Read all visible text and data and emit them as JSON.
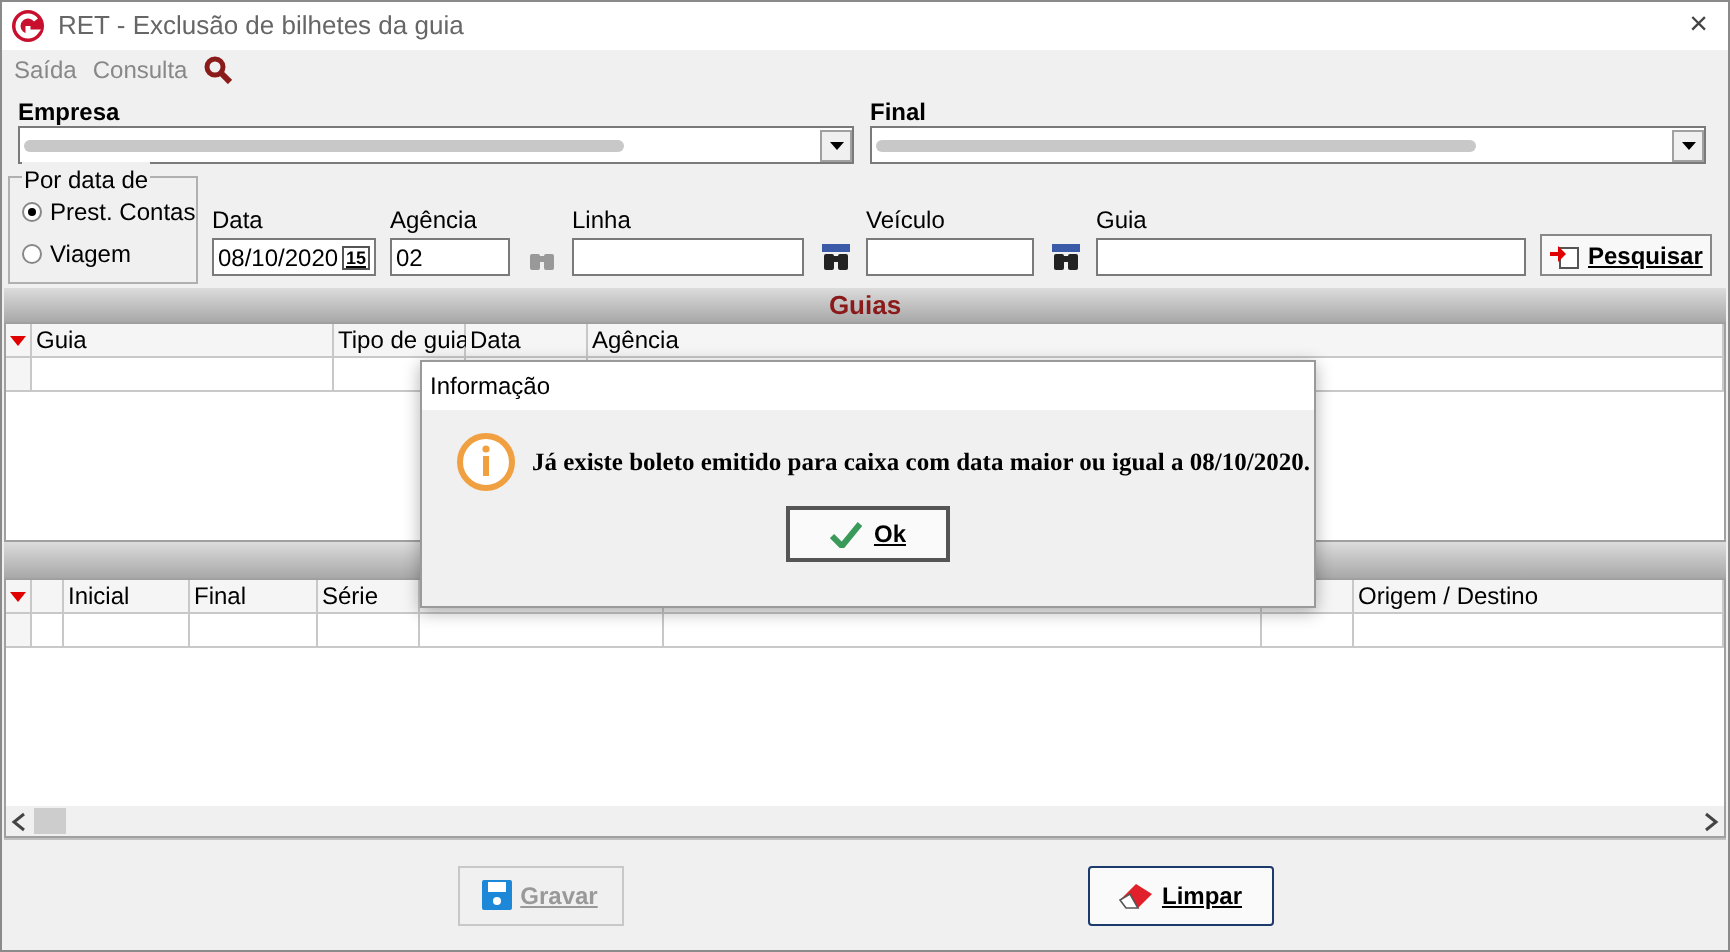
{
  "window": {
    "title": "RET - Exclusão de bilhetes da guia",
    "close": "×"
  },
  "menu": [
    {
      "label": "Saída",
      "kind": "text"
    },
    {
      "label": "Consulta",
      "kind": "text"
    },
    {
      "kind": "search"
    }
  ],
  "combos": [
    {
      "label": "Empresa"
    },
    {
      "label": "Final"
    }
  ],
  "period": {
    "title": "Por data de",
    "options": [
      {
        "label": "Prest. Contas",
        "selected": true
      },
      {
        "label": "Viagem",
        "selected": false
      }
    ]
  },
  "fields": [
    {
      "label": "Data",
      "value": "08/10/2020",
      "kind": "date",
      "calendar": "15"
    },
    {
      "label": "Agência",
      "value": "02",
      "kind": "lookup"
    },
    {
      "label": "Linha",
      "kind": "lookup"
    },
    {
      "label": "Veículo",
      "kind": "lookup"
    },
    {
      "label": "Guia",
      "kind": "plain"
    }
  ],
  "search_button": "Pesquisar",
  "guias": {
    "title": "Guias",
    "columns": [
      "Guia",
      "Tipo de guia",
      "Data",
      "Agência"
    ]
  },
  "tickets": {
    "columns": [
      "Inicial",
      "Final",
      "Série",
      null,
      null,
      null,
      "Origem / Destino"
    ]
  },
  "buttons": [
    {
      "label": "Gravar",
      "kind": "save",
      "disabled": true
    },
    {
      "label": "Limpar",
      "kind": "clear",
      "disabled": false
    }
  ],
  "dialog": {
    "title": "Informação",
    "message": "Já existe boleto emitido para caixa com data maior ou igual a 08/10/2020.",
    "button": "Ok"
  }
}
